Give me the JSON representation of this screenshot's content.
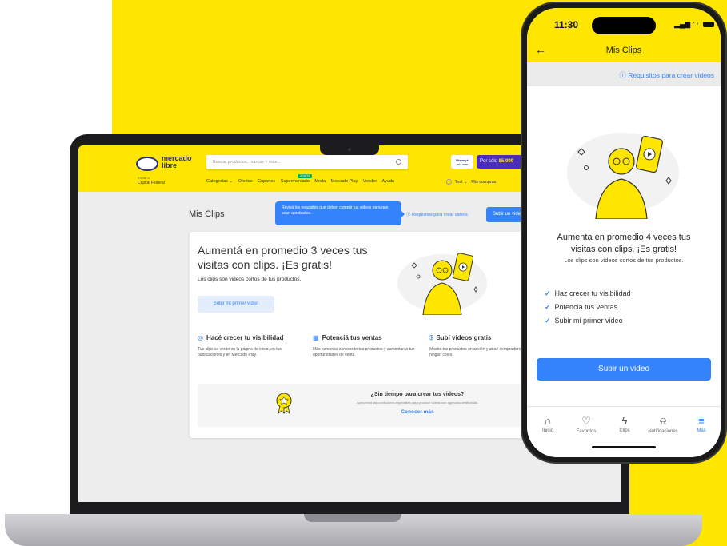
{
  "colors": {
    "brand_yellow": "#fee600",
    "accent_blue": "#3483fa",
    "laptop_frame": "#1c1c1e"
  },
  "desktop": {
    "logo": {
      "line1": "mercado",
      "line2": "libre"
    },
    "search": {
      "placeholder": "Buscar productos, marcas y más..."
    },
    "promo": {
      "disney_label": "Disney+",
      "disney_sub": "INCLUIDO",
      "price_prefix": "Por sólo",
      "price": "$5.999"
    },
    "location": {
      "line1": "Enviar a",
      "line2": "Capital Federal"
    },
    "nav": [
      "Categorías ⌄",
      "Ofertas",
      "Cupones",
      "Supermercado",
      "Moda",
      "Mercado Play",
      "Vender",
      "Ayuda"
    ],
    "nav_new_badge": "GRATIS",
    "user_nav": {
      "avatar": "TT",
      "user": "Test ⌄",
      "purchases": "Mis compras"
    },
    "page_title": "Mis Clips",
    "tooltip": "Revisá los requisitos que deben cumplir tus videos para que sean aprobados.",
    "requirements_link": "Requisitos para crear videos",
    "upload_button": "Subir un video",
    "hero": {
      "title": "Aumentá en promedio 3 veces tus visitas con clips. ¡Es gratis!",
      "subtitle": "Los clips son videos cortos de tus productos.",
      "button": "Subir mi primer video"
    },
    "features": [
      {
        "icon": "eye-icon",
        "glyph": "◎",
        "title": "Hacé crecer tu visibilidad",
        "desc": "Tus clips se verán en la página de inicio, en tus publicaciones y en Mercado Play."
      },
      {
        "icon": "shop-icon",
        "glyph": "▦",
        "title": "Potenciá tus ventas",
        "desc": "Más personas conocerán tus productos y aumentarás tus oportunidades de venta."
      },
      {
        "icon": "money-icon",
        "glyph": "$",
        "title": "Subí videos gratis",
        "desc": "Mostrá tus productos en acción y atraé compradores sin ningún costo."
      }
    ],
    "cta": {
      "title": "¿Sin tiempo para crear tus videos?",
      "desc": "Aprovechá las condiciones especiales para producir videos con agencias certificadas.",
      "link": "Conocer más"
    }
  },
  "mobile": {
    "time": "11:30",
    "title": "Mis Clips",
    "requirements_link": "Requisitos para crear videos",
    "hero_title": "Aumenta en promedio 4 veces tus visitas con clips. ¡Es gratis!",
    "hero_subtitle": "Los clips son videos cortos de tus productos.",
    "benefits": [
      "Haz crecer tu visibilidad",
      "Potencia tus ventas",
      "Subir mi primer video"
    ],
    "button": "Subir un video",
    "tabs": [
      {
        "label": "Inicio",
        "icon": "home-icon",
        "glyph": "⌂",
        "active": false
      },
      {
        "label": "Favoritos",
        "icon": "heart-icon",
        "glyph": "♡",
        "active": false
      },
      {
        "label": "Clips",
        "icon": "bolt-icon",
        "glyph": "ϟ",
        "active": false
      },
      {
        "label": "Notificaciones",
        "icon": "bell-icon",
        "glyph": "⍾",
        "active": false
      },
      {
        "label": "Más",
        "icon": "menu-icon",
        "glyph": "≡",
        "active": true
      }
    ]
  }
}
